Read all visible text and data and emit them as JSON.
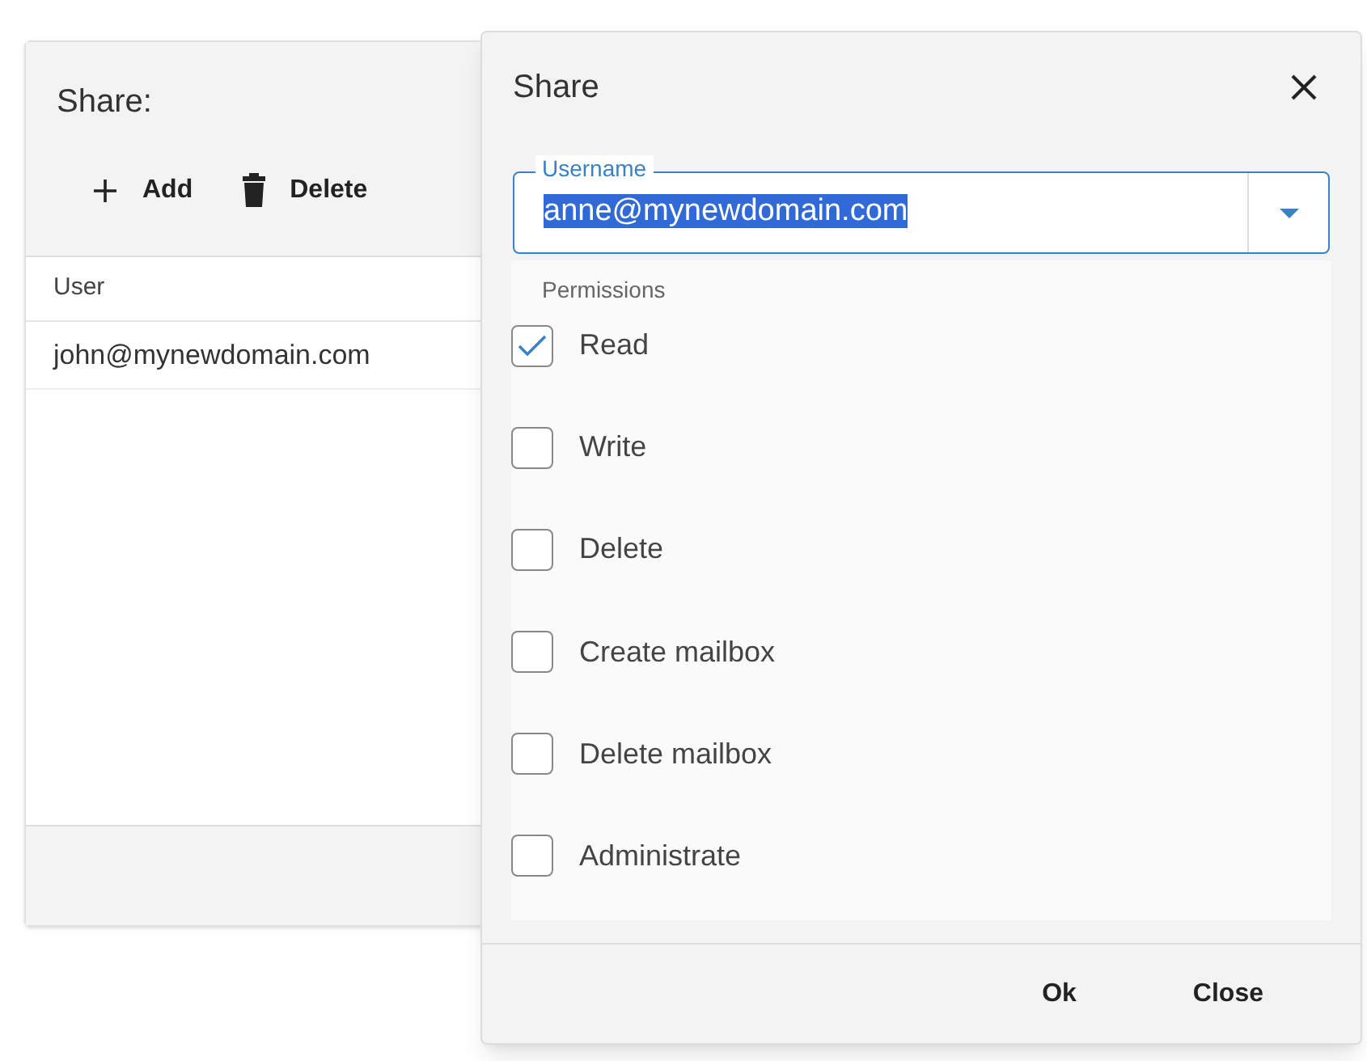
{
  "background_panel": {
    "title": "Share:",
    "toolbar": [
      {
        "kind": "add",
        "label": "Add"
      },
      {
        "kind": "delete",
        "label": "Delete"
      }
    ],
    "table": {
      "columns": [
        "User"
      ],
      "rows": [
        [
          "john@mynewdomain.com"
        ]
      ]
    }
  },
  "dialog": {
    "title": "Share",
    "username": {
      "label": "Username",
      "value": "anne@mynewdomain.com",
      "text_selected": true
    },
    "permissions_label": "Permissions",
    "permissions": [
      {
        "label": "Read",
        "checked": true
      },
      {
        "label": "Write",
        "checked": false
      },
      {
        "label": "Delete",
        "checked": false
      },
      {
        "label": "Create mailbox",
        "checked": false
      },
      {
        "label": "Delete mailbox",
        "checked": false
      },
      {
        "label": "Administrate",
        "checked": false
      }
    ],
    "buttons": [
      "Ok",
      "Close"
    ]
  }
}
